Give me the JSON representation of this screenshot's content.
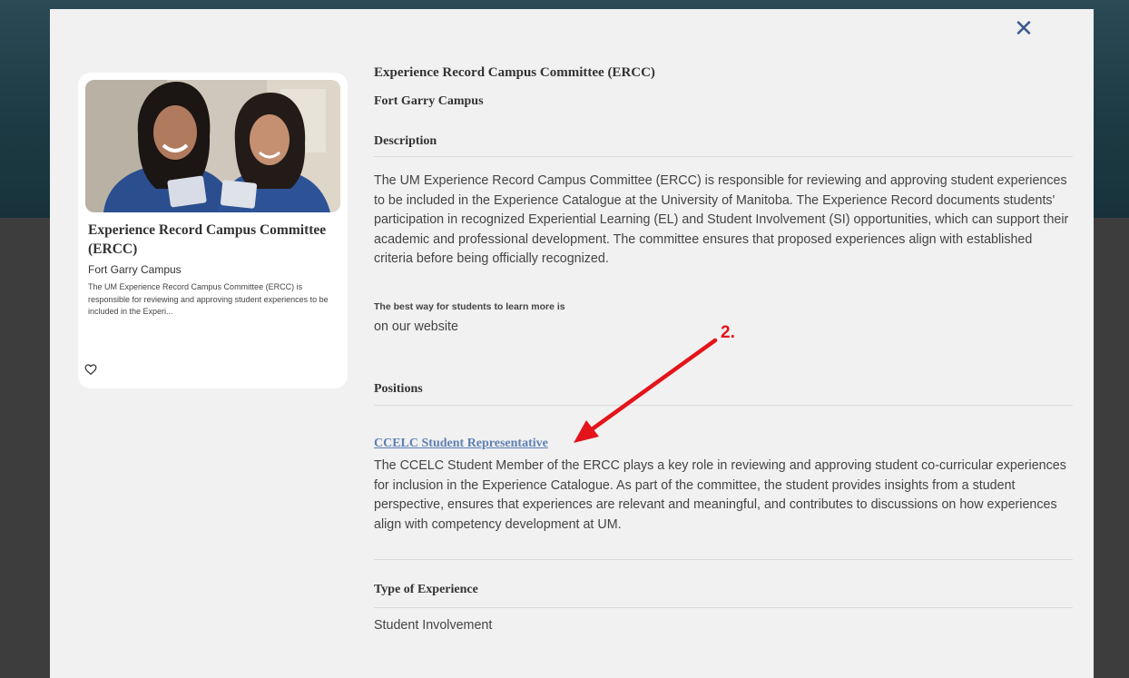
{
  "modal": {
    "close_glyph": "✕",
    "card": {
      "title": "Experience Record Campus Committee (ERCC)",
      "campus": "Fort Garry Campus",
      "description": "The UM Experience Record Campus Committee (ERCC) is responsible for reviewing and approving student experiences to be included in the Experi...",
      "favorite_icon": "heart-outline-icon"
    },
    "detail": {
      "title": "Experience Record Campus Committee (ERCC)",
      "campus": "Fort Garry Campus",
      "description_heading": "Description",
      "description": "The UM Experience Record Campus Committee (ERCC) is responsible for reviewing and approving student experiences to be included in the Experience Catalogue at the University of Manitoba. The Experience Record documents students' participation in recognized Experiential Learning (EL) and Student Involvement (SI) opportunities, which can support their academic and professional development. The committee ensures that proposed experiences align with established criteria before being officially recognized.",
      "learn_more_label": "The best way for students to learn more is",
      "learn_more_value": "on our website",
      "positions_heading": "Positions",
      "positions": [
        {
          "title": "CCELC Student Representative",
          "description": "The CCELC Student Member of the ERCC plays a key role in reviewing and approving student co-curricular experiences for inclusion in the Experience Catalogue. As part of the committee, the student provides insights from a student perspective, ensures that experiences are relevant and meaningful, and contributes to discussions on how experiences align with competency development at UM."
        }
      ],
      "type_heading": "Type of Experience",
      "type_value": "Student Involvement"
    }
  },
  "annotation": {
    "label": "2.",
    "color": "#e3141a"
  },
  "colors": {
    "link": "#5d7fb3",
    "close": "#3b5b8c",
    "modal_bg": "#f1f1f1",
    "card_bg": "#ffffff"
  }
}
